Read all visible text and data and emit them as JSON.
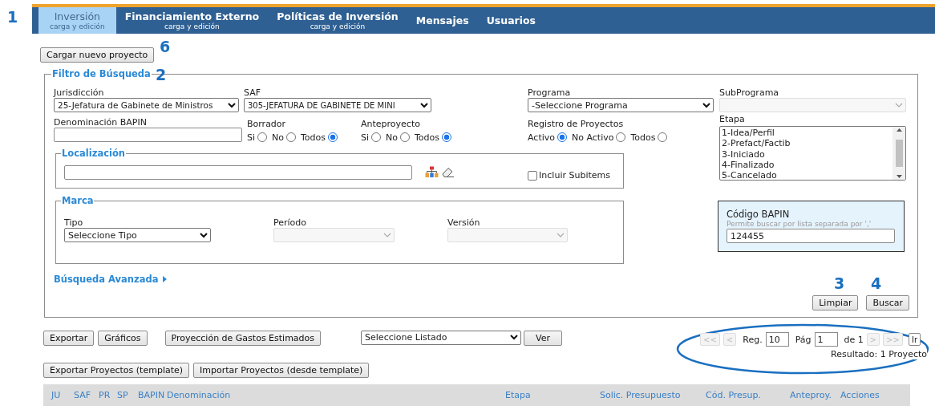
{
  "annotations": [
    {
      "label": "1"
    },
    {
      "label": "6"
    },
    {
      "label": "2"
    },
    {
      "label": "3"
    },
    {
      "label": "4"
    }
  ],
  "nav_tabs": [
    {
      "label": "Inversión",
      "sublabel": "carga y edición",
      "selected": true
    },
    {
      "label": "Financiamiento Externo",
      "sublabel": "carga y edición",
      "selected": false
    },
    {
      "label": "Políticas de Inversión",
      "sublabel": "carga y edición",
      "selected": false
    },
    {
      "label": "Mensajes",
      "selected": false
    },
    {
      "label": "Usuarios",
      "selected": false
    }
  ],
  "new_project_button": "Cargar nuevo proyecto",
  "filter": {
    "legend": "Filtro de Búsqueda",
    "jurisdiccion": {
      "label": "Jurisdicción",
      "value": "25-Jefatura de Gabinete de Ministros",
      "disabled": false
    },
    "saf": {
      "label": "SAF",
      "value": "305-JEFATURA DE GABINETE DE MINI",
      "disabled": false
    },
    "programa": {
      "label": "Programa",
      "value": "-Seleccione Programa",
      "disabled": false
    },
    "subprograma": {
      "label": "SubPrograma",
      "disabled": true
    },
    "denominacion": {
      "label": "Denominación BAPIN"
    },
    "borrador": {
      "label": "Borrador",
      "options": [
        {
          "label": "Si",
          "selected": false
        },
        {
          "label": "No",
          "selected": false
        },
        {
          "label": "Todos",
          "selected": true
        }
      ]
    },
    "anteproyecto": {
      "label": "Anteproyecto",
      "options": [
        {
          "label": "Si",
          "selected": false
        },
        {
          "label": "No",
          "selected": false
        },
        {
          "label": "Todos",
          "selected": true
        }
      ]
    },
    "registro": {
      "label": "Registro de Proyectos",
      "options": [
        {
          "label": "Activo",
          "selected": true
        },
        {
          "label": "No Activo",
          "selected": false
        },
        {
          "label": "Todos",
          "selected": false
        }
      ]
    },
    "etapa": {
      "label": "Etapa",
      "options": [
        {
          "label": "1-Idea/Perfil",
          "selected": false
        },
        {
          "label": "2-Prefact/Factib",
          "selected": false
        },
        {
          "label": "3-Iniciado",
          "selected": false
        },
        {
          "label": "4-Finalizado",
          "selected": false
        },
        {
          "label": "5-Cancelado",
          "selected": false
        }
      ]
    },
    "localizacion": {
      "legend": "Localización",
      "include_subitems": {
        "label": "Incluir Subitems",
        "checked": false
      }
    },
    "marca": {
      "legend": "Marca",
      "tipo": {
        "label": "Tipo",
        "value": "Seleccione Tipo",
        "disabled": false
      },
      "periodo": {
        "label": "Período",
        "disabled": true
      },
      "version": {
        "label": "Versión",
        "disabled": true
      }
    },
    "codigo_bapin": {
      "label": "Código BAPIN",
      "hint": "Permite buscar por lista separada por ','",
      "value": "124455"
    },
    "advanced_search": "Búsqueda Avanzada",
    "buttons": [
      "Limpiar",
      "Buscar"
    ]
  },
  "toolbar": {
    "buttons": [
      "Exportar",
      "Gráficos",
      "Proyección de Gastos Estimados"
    ],
    "listado": "Seleccione Listado",
    "ver_button": "Ver"
  },
  "pagination": {
    "back_buttons": [
      {
        "label": "<<",
        "disabled": true
      },
      {
        "label": "<",
        "disabled": true
      }
    ],
    "reg_label": "Reg.",
    "reg_value": "10",
    "page_label": "Pág",
    "page_value": "1",
    "page_count": "de 1",
    "forward_buttons": [
      {
        "label": ">",
        "disabled": true
      },
      {
        "label": ">>",
        "disabled": true
      }
    ],
    "go_button": "Ir",
    "result": "Resultado: 1 Proyecto"
  },
  "template_buttons": [
    "Exportar Proyectos (template)",
    "Importar Proyectos (desde template)"
  ],
  "table": {
    "columns": [
      "JU",
      "SAF",
      "PR",
      "SP",
      "BAPIN",
      "Denominación",
      "Etapa",
      "Solic. Presupuesto",
      "Cód. Presup.",
      "Anteproy.",
      "Acciones"
    ]
  }
}
